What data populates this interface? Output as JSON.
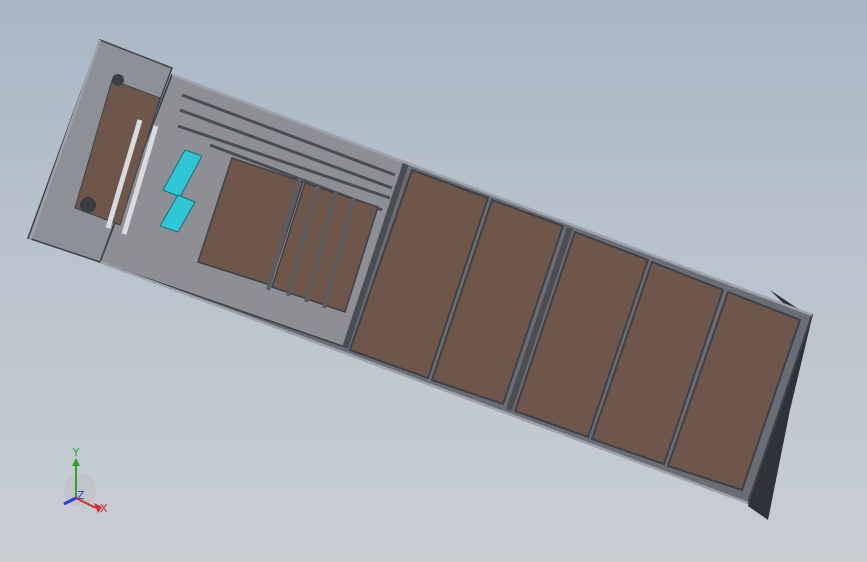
{
  "viewport": {
    "background_top": "#a9b7c5",
    "background_bottom": "#c9ced3"
  },
  "model": {
    "frame_color": "#7c7f86",
    "frame_dark": "#4a4d54",
    "panel_color": "#6f564b",
    "accent_color": "#2fc7d6",
    "panel_count": 9
  },
  "triad": {
    "x_label": "X",
    "y_label": "Y",
    "z_label": "Z",
    "x_color": "#d62a2a",
    "y_color": "#2aa52a",
    "z_color": "#2a3fd6"
  }
}
